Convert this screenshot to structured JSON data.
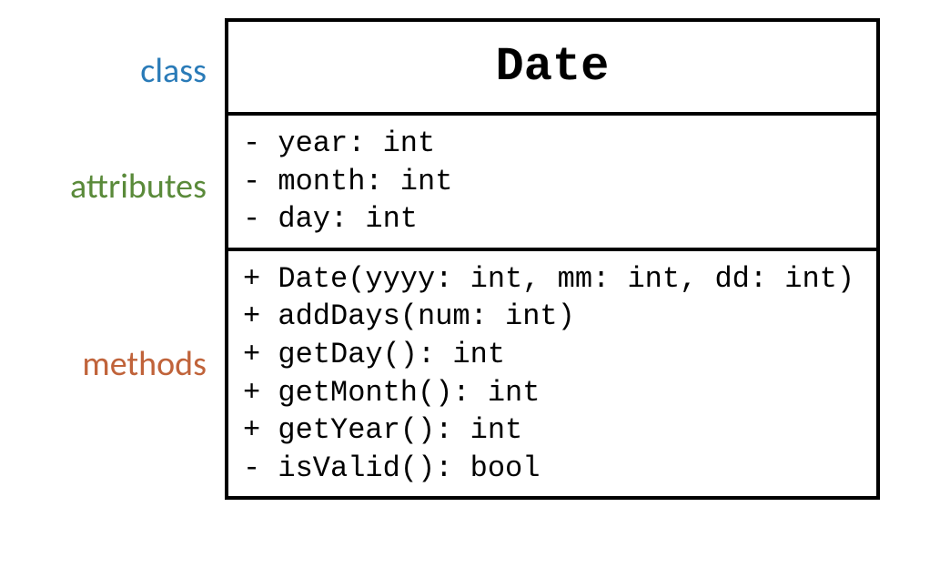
{
  "labels": {
    "class": "class",
    "attributes": "attributes",
    "methods": "methods"
  },
  "class_name": "Date",
  "attributes": [
    "- year: int",
    "- month: int",
    "- day: int"
  ],
  "methods": [
    "+ Date(yyyy: int, mm: int, dd: int)",
    "+ addDays(num: int)",
    "+ getDay(): int",
    "+ getMonth(): int",
    "+ getYear(): int",
    "- isValid(): bool"
  ]
}
